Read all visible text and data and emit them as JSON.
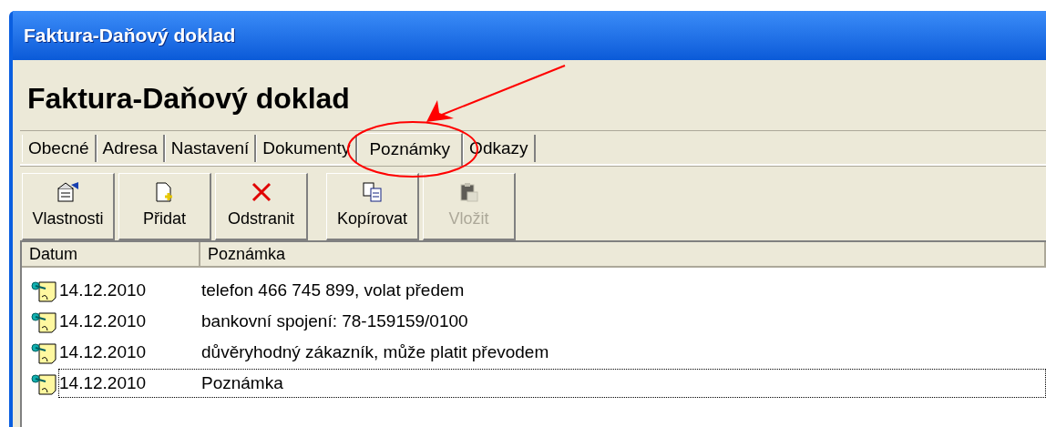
{
  "window": {
    "title": "Faktura-Daňový doklad"
  },
  "heading": "Faktura-Daňový doklad",
  "tabs": [
    {
      "label": "Obecné",
      "selected": false
    },
    {
      "label": "Adresa",
      "selected": false
    },
    {
      "label": "Nastavení",
      "selected": false
    },
    {
      "label": "Dokumenty",
      "selected": false
    },
    {
      "label": "Poznámky",
      "selected": true
    },
    {
      "label": "Odkazy",
      "selected": false
    }
  ],
  "toolbar": {
    "buttons": [
      {
        "label": "Vlastnosti",
        "kind": "properties",
        "disabled": false
      },
      {
        "label": "Přidat",
        "kind": "add",
        "disabled": false
      },
      {
        "label": "Odstranit",
        "kind": "delete",
        "disabled": false
      },
      {
        "label": "Kopírovat",
        "kind": "copy",
        "disabled": false
      },
      {
        "label": "Vložit",
        "kind": "paste",
        "disabled": true
      }
    ]
  },
  "list": {
    "columns": [
      "Datum",
      "Poznámka"
    ],
    "rows": [
      {
        "date": "14.12.2010",
        "note": "telefon 466 745 899, volat předem",
        "focused": false
      },
      {
        "date": "14.12.2010",
        "note": "bankovní spojení: 78-159159/0100",
        "focused": false
      },
      {
        "date": "14.12.2010",
        "note": "důvěryhodný zákazník, může platit převodem",
        "focused": false
      },
      {
        "date": "14.12.2010",
        "note": "Poznámka",
        "focused": true
      }
    ]
  }
}
